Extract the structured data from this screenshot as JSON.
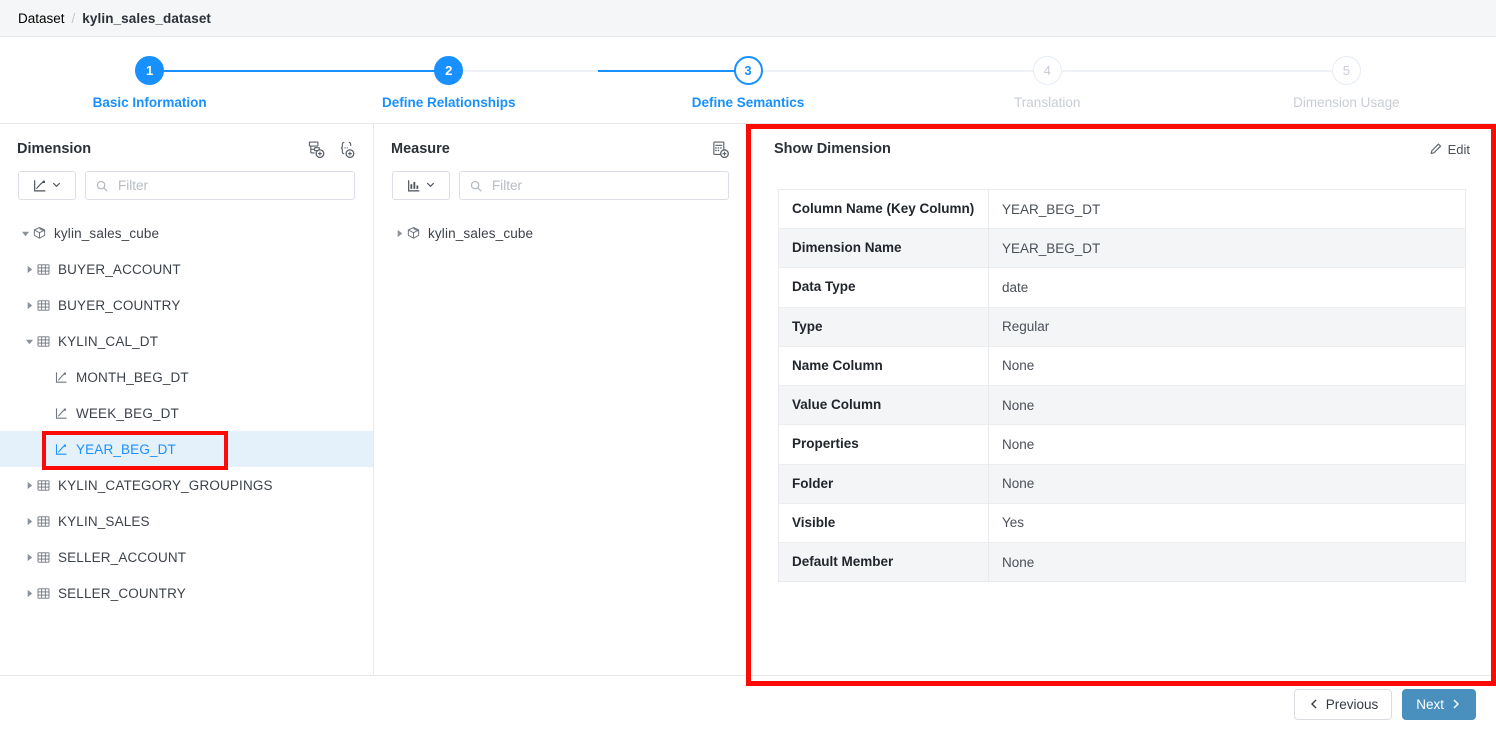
{
  "breadcrumb": {
    "root": "Dataset",
    "separator": "/",
    "current": "kylin_sales_dataset"
  },
  "stepper": {
    "steps": [
      {
        "num": "1",
        "label": "Basic Information",
        "state": "done"
      },
      {
        "num": "2",
        "label": "Define Relationships",
        "state": "done"
      },
      {
        "num": "3",
        "label": "Define Semantics",
        "state": "current"
      },
      {
        "num": "4",
        "label": "Translation",
        "state": "todo"
      },
      {
        "num": "5",
        "label": "Dimension Usage",
        "state": "todo"
      }
    ]
  },
  "dimension_panel": {
    "title": "Dimension",
    "tools": [
      {
        "icon": "add-hierarchy-icon"
      },
      {
        "icon": "add-named-set-icon"
      }
    ],
    "type_filter_icon": "dimension-axis-icon",
    "filter_placeholder": "Filter",
    "filter_value": "",
    "tree": [
      {
        "label": "kylin_sales_cube",
        "level": 0,
        "icon": "cube-icon",
        "caret": "open",
        "selected": false
      },
      {
        "label": "BUYER_ACCOUNT",
        "level": 1,
        "icon": "table-icon",
        "caret": "closed",
        "selected": false
      },
      {
        "label": "BUYER_COUNTRY",
        "level": 1,
        "icon": "table-icon",
        "caret": "closed",
        "selected": false
      },
      {
        "label": "KYLIN_CAL_DT",
        "level": 1,
        "icon": "table-icon",
        "caret": "open",
        "selected": false
      },
      {
        "label": "MONTH_BEG_DT",
        "level": 2,
        "icon": "dimension-axis-icon",
        "caret": "none",
        "selected": false
      },
      {
        "label": "WEEK_BEG_DT",
        "level": 2,
        "icon": "dimension-axis-icon",
        "caret": "none",
        "selected": false
      },
      {
        "label": "YEAR_BEG_DT",
        "level": 2,
        "icon": "dimension-axis-icon",
        "caret": "none",
        "selected": true
      },
      {
        "label": "KYLIN_CATEGORY_GROUPINGS",
        "level": 1,
        "icon": "table-icon",
        "caret": "closed",
        "selected": false
      },
      {
        "label": "KYLIN_SALES",
        "level": 1,
        "icon": "table-icon",
        "caret": "closed",
        "selected": false
      },
      {
        "label": "SELLER_ACCOUNT",
        "level": 1,
        "icon": "table-icon",
        "caret": "closed",
        "selected": false
      },
      {
        "label": "SELLER_COUNTRY",
        "level": 1,
        "icon": "table-icon",
        "caret": "closed",
        "selected": false
      }
    ]
  },
  "measure_panel": {
    "title": "Measure",
    "tools": [
      {
        "icon": "add-calculated-measure-icon"
      }
    ],
    "type_filter_icon": "measure-bar-icon",
    "filter_placeholder": "Filter",
    "filter_value": "",
    "tree": [
      {
        "label": "kylin_sales_cube",
        "level": 0,
        "icon": "cube-icon",
        "caret": "closed",
        "selected": false
      }
    ]
  },
  "detail_panel": {
    "title": "Show Dimension",
    "edit_label": "Edit",
    "edit_icon": "pencil-icon",
    "rows": [
      {
        "key": "Column Name (Key Column)",
        "value": "YEAR_BEG_DT"
      },
      {
        "key": "Dimension Name",
        "value": "YEAR_BEG_DT"
      },
      {
        "key": "Data Type",
        "value": "date"
      },
      {
        "key": "Type",
        "value": "Regular"
      },
      {
        "key": "Name Column",
        "value": "None"
      },
      {
        "key": "Value Column",
        "value": "None"
      },
      {
        "key": "Properties",
        "value": "None"
      },
      {
        "key": "Folder",
        "value": "None"
      },
      {
        "key": "Visible",
        "value": "Yes"
      },
      {
        "key": "Default Member",
        "value": "None"
      }
    ]
  },
  "footer": {
    "previous_label": "Previous",
    "next_label": "Next"
  },
  "colors": {
    "accent_blue": "#1890ff",
    "next_button": "#4a90bf",
    "selected_row": "#e4f0fa",
    "annotation_red": "#fb0b05",
    "inactive_gray": "#c8cdd4"
  }
}
